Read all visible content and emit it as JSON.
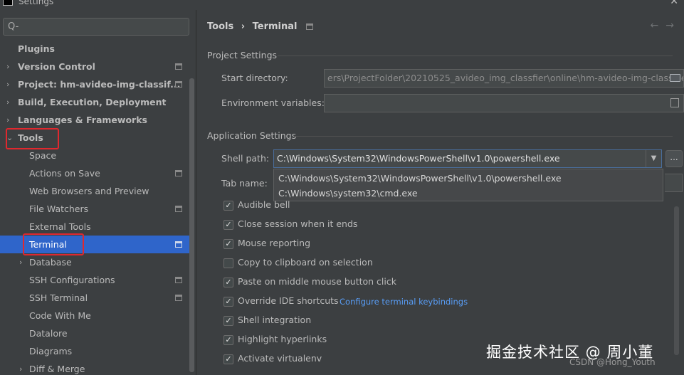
{
  "window": {
    "title": "Settings"
  },
  "search": {
    "placeholder": "Q-"
  },
  "sidebar": {
    "items": [
      {
        "label": "Plugins",
        "bold": true,
        "arrow": "",
        "proj": false
      },
      {
        "label": "Version Control",
        "bold": true,
        "arrow": "›",
        "proj": true
      },
      {
        "label": "Project: hm-avideo-img-classif...",
        "bold": true,
        "arrow": "›",
        "proj": true
      },
      {
        "label": "Build, Execution, Deployment",
        "bold": true,
        "arrow": "›",
        "proj": false
      },
      {
        "label": "Languages & Frameworks",
        "bold": true,
        "arrow": "›",
        "proj": false
      },
      {
        "label": "Tools",
        "bold": true,
        "arrow": "⌄",
        "proj": false
      },
      {
        "label": "Space",
        "bold": false,
        "arrow": "",
        "proj": false
      },
      {
        "label": "Actions on Save",
        "bold": false,
        "arrow": "",
        "proj": true
      },
      {
        "label": "Web Browsers and Preview",
        "bold": false,
        "arrow": "",
        "proj": false
      },
      {
        "label": "File Watchers",
        "bold": false,
        "arrow": "",
        "proj": true
      },
      {
        "label": "External Tools",
        "bold": false,
        "arrow": "",
        "proj": false
      },
      {
        "label": "Terminal",
        "bold": false,
        "arrow": "",
        "proj": true,
        "selected": true
      },
      {
        "label": "Database",
        "bold": false,
        "arrow": "›",
        "proj": false
      },
      {
        "label": "SSH Configurations",
        "bold": false,
        "arrow": "",
        "proj": true
      },
      {
        "label": "SSH Terminal",
        "bold": false,
        "arrow": "",
        "proj": true
      },
      {
        "label": "Code With Me",
        "bold": false,
        "arrow": "",
        "proj": false
      },
      {
        "label": "Datalore",
        "bold": false,
        "arrow": "",
        "proj": false
      },
      {
        "label": "Diagrams",
        "bold": false,
        "arrow": "",
        "proj": false
      },
      {
        "label": "Diff & Merge",
        "bold": false,
        "arrow": "›",
        "proj": false
      }
    ]
  },
  "breadcrumb": {
    "parent": "Tools",
    "separator": "›",
    "current": "Terminal"
  },
  "nav": {
    "back": "←",
    "forward": "→"
  },
  "project_settings": {
    "title": "Project Settings",
    "start_dir_label": "Start directory:",
    "start_dir_value": "ers\\ProjectFolder\\20210525_avideo_img_classfier\\online\\hm-avideo-img-classifier",
    "env_label": "Environment variables:",
    "env_value": ""
  },
  "app_settings": {
    "title": "Application Settings",
    "shell_label": "Shell path:",
    "shell_value": "C:\\Windows\\System32\\WindowsPowerShell\\v1.0\\powershell.exe",
    "shell_options": [
      "C:\\Windows\\System32\\WindowsPowerShell\\v1.0\\powershell.exe",
      "C:\\Windows\\system32\\cmd.exe"
    ],
    "browse_label": "...",
    "tab_label": "Tab name:"
  },
  "checkboxes": [
    {
      "label": "Audible bell",
      "checked": true
    },
    {
      "label": "Close session when it ends",
      "checked": true
    },
    {
      "label": "Mouse reporting",
      "checked": true
    },
    {
      "label": "Copy to clipboard on selection",
      "checked": false
    },
    {
      "label": "Paste on middle mouse button click",
      "checked": true
    },
    {
      "label": "Override IDE shortcuts",
      "checked": true
    },
    {
      "label": "Shell integration",
      "checked": true
    },
    {
      "label": "Highlight hyperlinks",
      "checked": true
    },
    {
      "label": "Activate virtualenv",
      "checked": true
    }
  ],
  "links": {
    "keybindings": "Configure terminal keybindings"
  },
  "watermark": {
    "main": "掘金技术社区 @ 周小董",
    "sub": "CSDN @Hong_Youth"
  },
  "colors": {
    "selection": "#2f65ca",
    "highlight_box": "#e0282e",
    "link": "#589df6"
  }
}
